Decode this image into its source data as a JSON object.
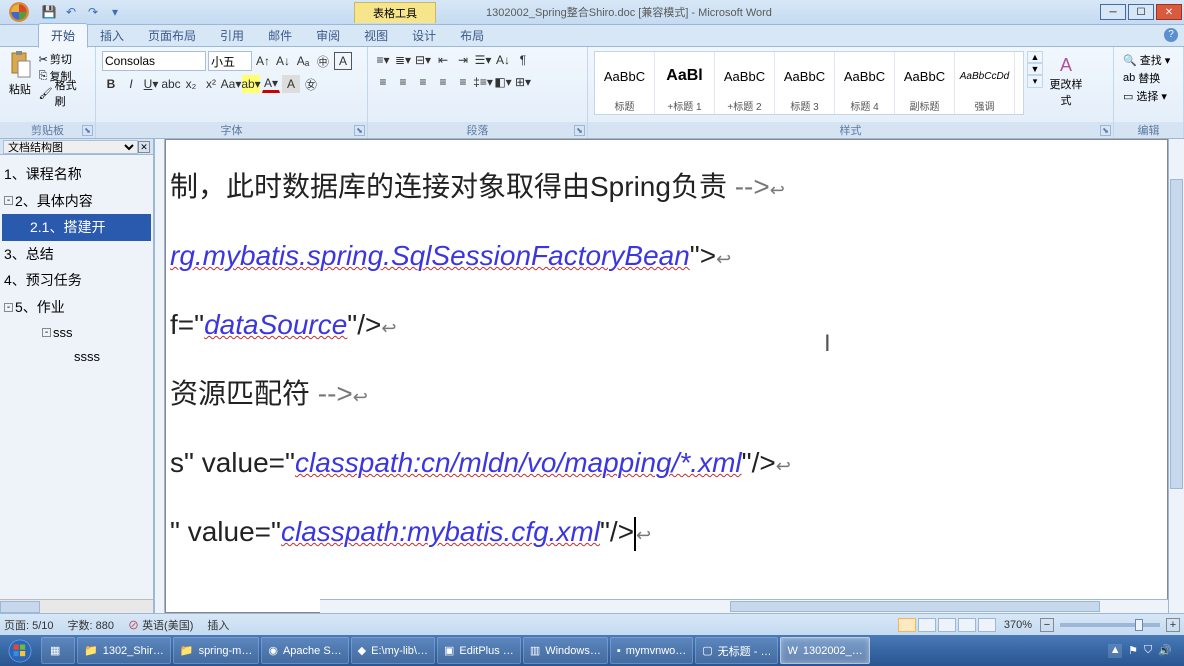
{
  "titlebar": {
    "context_tab": "表格工具",
    "title": "1302002_Spring整合Shiro.doc [兼容模式] - Microsoft Word"
  },
  "tabs": [
    "开始",
    "插入",
    "页面布局",
    "引用",
    "邮件",
    "审阅",
    "视图",
    "设计",
    "布局"
  ],
  "clipboard": {
    "paste": "粘贴",
    "cut": "剪切",
    "copy": "复制",
    "format": "格式刷",
    "group": "剪贴板"
  },
  "font": {
    "name": "Consolas",
    "size": "小五",
    "group": "字体"
  },
  "para": {
    "group": "段落"
  },
  "styles": {
    "items": [
      {
        "preview": "AaBbC",
        "name": "标题"
      },
      {
        "preview": "AaBl",
        "name": "+标题 1"
      },
      {
        "preview": "AaBbC",
        "name": "+标题 2"
      },
      {
        "preview": "AaBbC",
        "name": "标题 3"
      },
      {
        "preview": "AaBbC",
        "name": "标题 4"
      },
      {
        "preview": "AaBbC",
        "name": "副标题"
      },
      {
        "preview": "AaBbCcDd",
        "name": "强调"
      }
    ],
    "change": "更改样式",
    "group": "样式"
  },
  "editing": {
    "find": "查找",
    "replace": "替换",
    "select": "选择",
    "group": "编辑"
  },
  "nav": {
    "title": "文档结构图",
    "items": [
      "1、课程名称",
      "2、具体内容",
      "2.1、搭建开",
      "3、总结",
      "4、预习任务",
      "5、作业",
      "sss",
      "ssss"
    ]
  },
  "content": {
    "l1a": "制，此时数据库的连接对象取得由Spring负责",
    "l1b": "  -->",
    "l2a": "rg.mybatis.spring.SqlSessionFactoryBean",
    "l2b": "\">",
    "l3a": "f=\"",
    "l3b": "dataSource",
    "l3c": "\"/>",
    "l4a": " 资源匹配符 ",
    "l4b": " -->",
    "l5a": "s\"",
    "l5b": "  value=\"",
    "l5c": "classpath:cn/mldn/vo/mapping/*.xml",
    "l5d": "\"/>",
    "l6a": "\"",
    "l6b": "  value=\"",
    "l6c": "classpath:mybatis.cfg.xml",
    "l6d": "\"/>"
  },
  "status": {
    "page": "页面: 5/10",
    "words": "字数: 880",
    "lang": "英语(美国)",
    "insert": "插入",
    "zoom": "370%"
  },
  "taskbar": {
    "items": [
      "1302_Shir…",
      "spring-m…",
      "Apache S…",
      "E:\\my-lib\\…",
      "EditPlus …",
      "Windows…",
      "mymvnwo…",
      "无标题 - …",
      "1302002_…"
    ]
  },
  "tray": {
    "time": ""
  }
}
